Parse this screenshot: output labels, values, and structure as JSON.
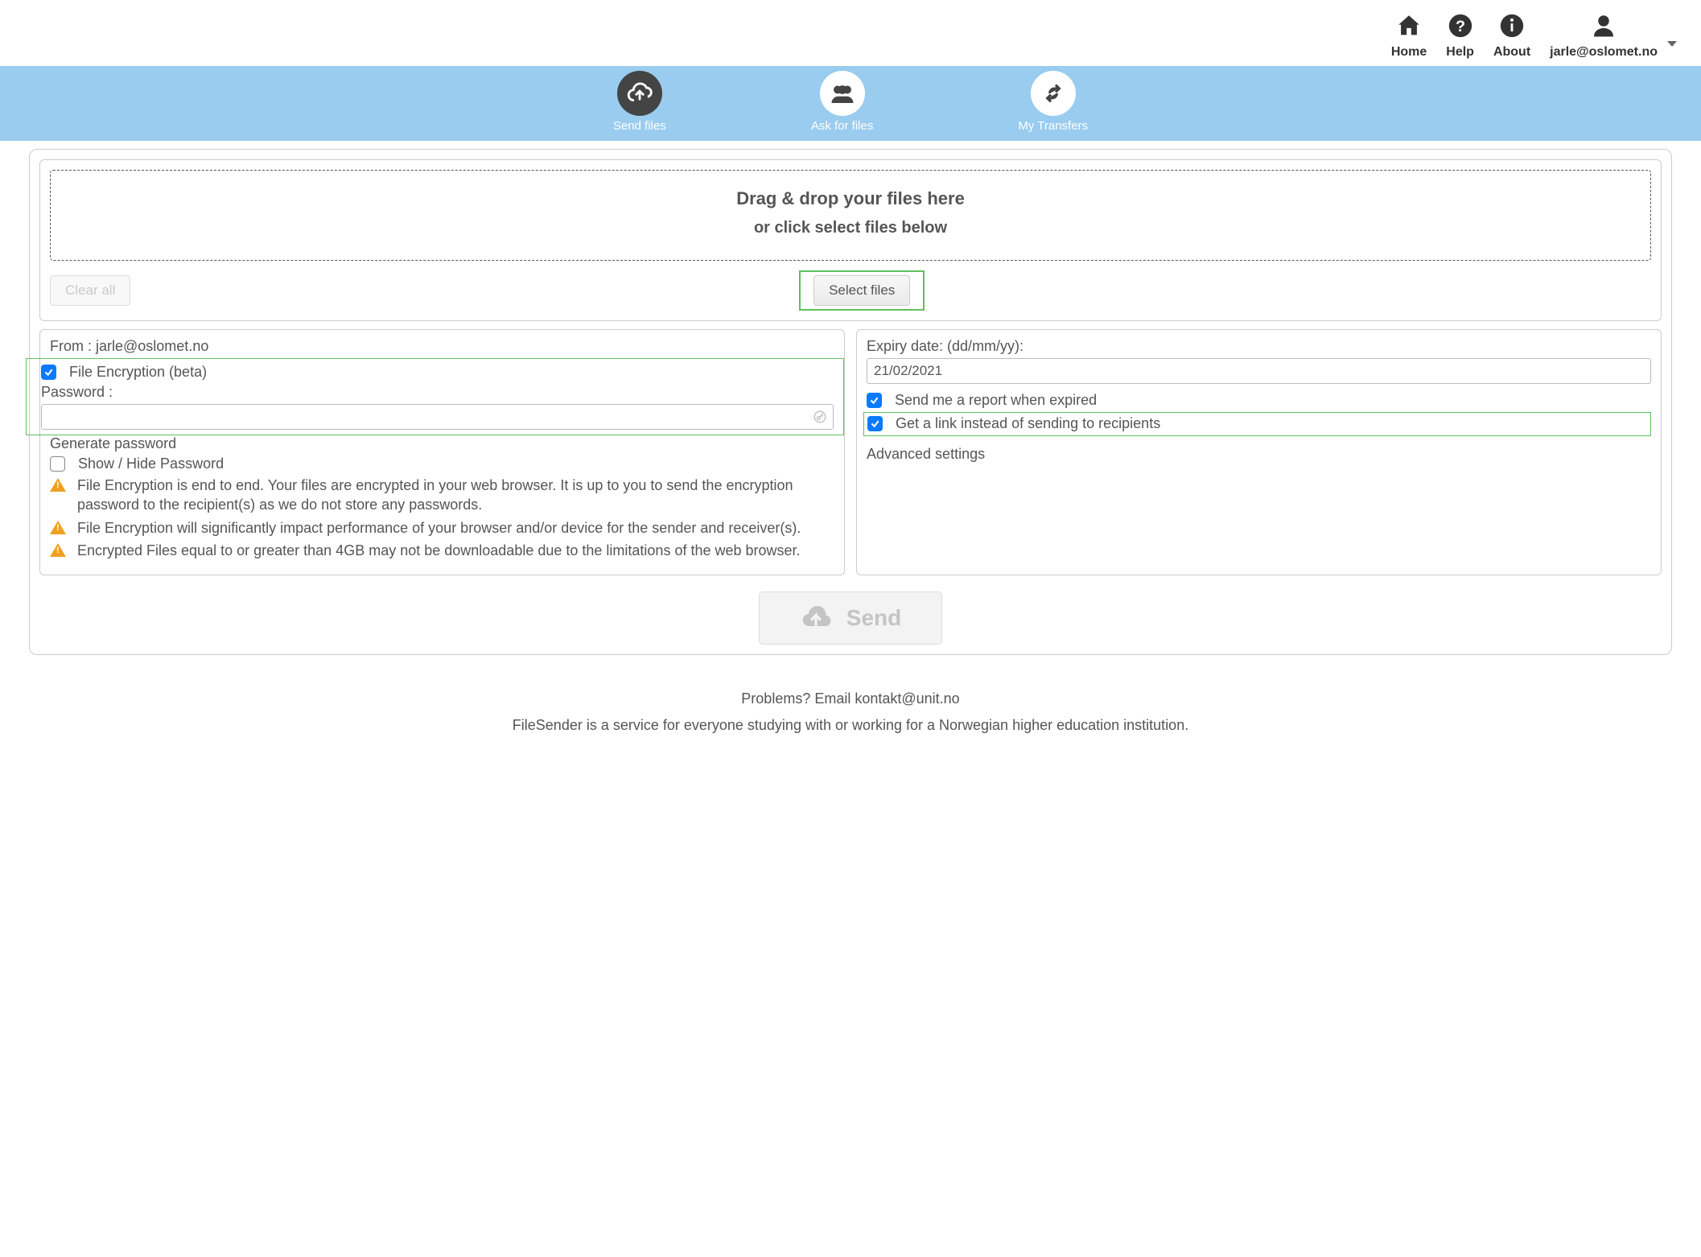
{
  "top_nav": {
    "home": "Home",
    "help": "Help",
    "about": "About",
    "user_email": "jarle@oslomet.no"
  },
  "blue_nav": {
    "send_files": "Send files",
    "ask_for_files": "Ask for files",
    "my_transfers": "My Transfers"
  },
  "upload": {
    "drop_line1": "Drag & drop your files here",
    "drop_line2": "or click select files below",
    "clear_all": "Clear all",
    "select_files": "Select files"
  },
  "left_panel": {
    "from_label": "From : ",
    "from_email": "jarle@oslomet.no",
    "file_encryption": "File Encryption (beta)",
    "password_label": "Password :",
    "generate_password": "Generate password",
    "show_hide_password": "Show / Hide Password",
    "warn1": "File Encryption is end to end. Your files are encrypted in your web browser. It is up to you to send the encryption password to the recipient(s) as we do not store any passwords.",
    "warn2": "File Encryption will significantly impact performance of your browser and/or device for the sender and receiver(s).",
    "warn3": "Encrypted Files equal to or greater than 4GB may not be downloadable due to the limitations of the web browser."
  },
  "right_panel": {
    "expiry_label": "Expiry date: (dd/mm/yy):",
    "expiry_value": "21/02/2021",
    "send_report": "Send me a report when expired",
    "get_link": "Get a link instead of sending to recipients",
    "advanced": "Advanced settings"
  },
  "send_button": "Send",
  "footer": {
    "problems_prefix": "Problems? Email ",
    "problems_email": "kontakt@unit.no",
    "desc": "FileSender is a service for everyone studying with or working for a Norwegian higher education institution."
  }
}
